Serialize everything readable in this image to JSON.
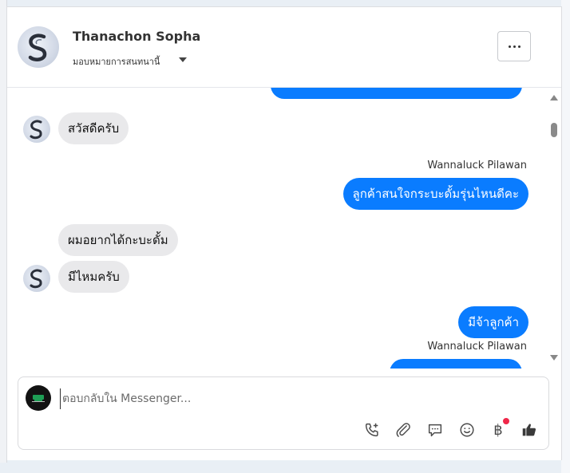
{
  "header": {
    "contact_name": "Thanachon Sopha",
    "assign_label": "มอบหมายการสนทนานี้"
  },
  "messages": [
    {
      "dir": "out",
      "text": "",
      "partial": "top"
    },
    {
      "dir": "in",
      "text": "สวัสดีครับ"
    },
    {
      "dir": "out",
      "sender": "Wannaluck Pilawan",
      "text": "ลูกค้าสนใจกระบะดั้มรุ่นไหนดีคะ"
    },
    {
      "dir": "in",
      "text": "ผมอยากได้กะบะดั้ม"
    },
    {
      "dir": "in",
      "text": "มีไหมครับ"
    },
    {
      "dir": "out",
      "text": "มีจ้าลูกค้า"
    },
    {
      "dir": "out",
      "sender": "Wannaluck Pilawan",
      "text": "",
      "partial": "bottom"
    }
  ],
  "composer": {
    "placeholder": "ตอบกลับใน Messenger...",
    "value": ""
  },
  "toolbar": {
    "icons": [
      "phone-plus-icon",
      "paperclip-icon",
      "chat-bubble-icon",
      "smiley-icon",
      "baht-icon",
      "thumbs-up-icon"
    ],
    "baht_symbol": "฿"
  },
  "colors": {
    "accent": "#0a7cff",
    "incoming_bubble": "#e9e9eb",
    "badge": "#f0284a"
  }
}
